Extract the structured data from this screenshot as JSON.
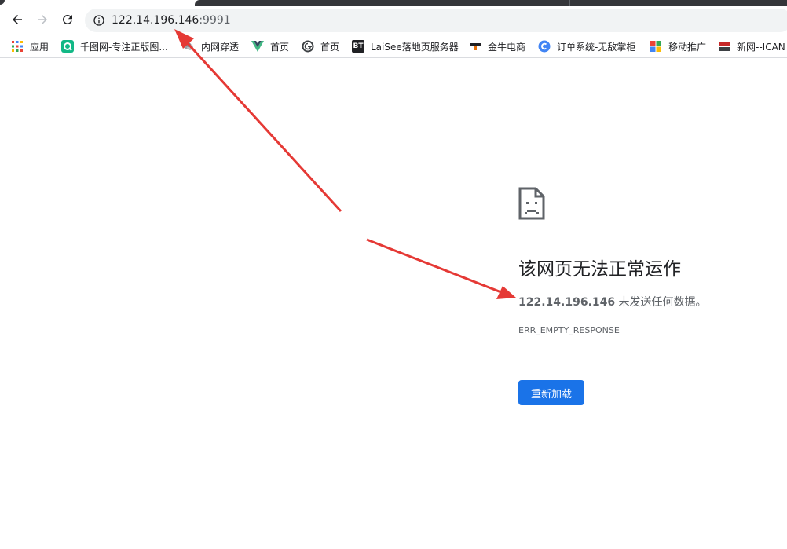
{
  "browser": {
    "address_bar": {
      "host": "122.14.196.146",
      "port": ":9991"
    }
  },
  "bookmarks": [
    {
      "label": "应用",
      "icon": "apps-grid-icon"
    },
    {
      "label": "千图网-专注正版图...",
      "icon": "qiantu-icon"
    },
    {
      "label": "内网穿透",
      "icon": "tunnel-icon"
    },
    {
      "label": "首页",
      "icon": "vue-icon"
    },
    {
      "label": "首页",
      "icon": "g-logo-icon"
    },
    {
      "label": "LaiSee落地页服务器",
      "icon": "bt-icon"
    },
    {
      "label": "金牛电商",
      "icon": "jinniu-icon"
    },
    {
      "label": "订单系统-无敌掌柜",
      "icon": "order-system-icon"
    },
    {
      "label": "移动推广",
      "icon": "colored-squares-icon"
    },
    {
      "label": "新网--ICAN",
      "icon": "xinnet-icon"
    }
  ],
  "bookmark_icon_labels": {
    "bt": "BT"
  },
  "error_page": {
    "title": "该网页无法正常运作",
    "host": "122.14.196.146",
    "desc_suffix": " 未发送任何数据。",
    "code": "ERR_EMPTY_RESPONSE",
    "reload_label": "重新加载"
  },
  "colors": {
    "accent": "#1a73e8",
    "arrow": "#e53935",
    "text_primary": "#202124",
    "text_secondary": "#5f6368"
  }
}
